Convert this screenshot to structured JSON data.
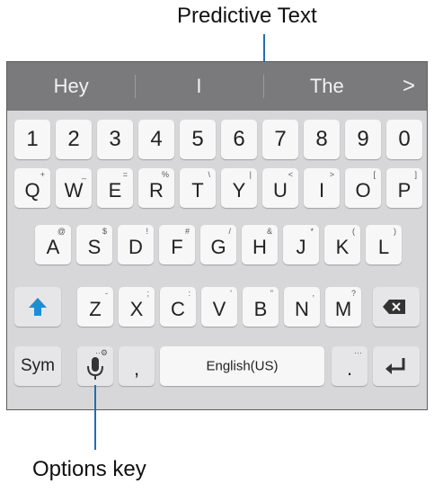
{
  "callouts": {
    "top": "Predictive Text",
    "bottom": "Options key"
  },
  "prediction": {
    "words": [
      "Hey",
      "I",
      "The"
    ],
    "more": ">"
  },
  "keyboard": {
    "numbers": [
      "1",
      "2",
      "3",
      "4",
      "5",
      "6",
      "7",
      "8",
      "9",
      "0"
    ],
    "row1": [
      {
        "main": "Q",
        "sub": "+"
      },
      {
        "main": "W",
        "sub": "_"
      },
      {
        "main": "E",
        "sub": "="
      },
      {
        "main": "R",
        "sub": "%"
      },
      {
        "main": "T",
        "sub": "\\"
      },
      {
        "main": "Y",
        "sub": "|"
      },
      {
        "main": "U",
        "sub": "<"
      },
      {
        "main": "I",
        "sub": ">"
      },
      {
        "main": "O",
        "sub": "["
      },
      {
        "main": "P",
        "sub": "]"
      }
    ],
    "row2": [
      {
        "main": "A",
        "sub": "@"
      },
      {
        "main": "S",
        "sub": "$"
      },
      {
        "main": "D",
        "sub": "!"
      },
      {
        "main": "F",
        "sub": "#"
      },
      {
        "main": "G",
        "sub": "/"
      },
      {
        "main": "H",
        "sub": "&"
      },
      {
        "main": "J",
        "sub": "*"
      },
      {
        "main": "K",
        "sub": "("
      },
      {
        "main": "L",
        "sub": ")"
      }
    ],
    "row3": [
      {
        "main": "Z",
        "sub": "-"
      },
      {
        "main": "X",
        "sub": ";"
      },
      {
        "main": "C",
        "sub": ":"
      },
      {
        "main": "V",
        "sub": "'"
      },
      {
        "main": "B",
        "sub": "\""
      },
      {
        "main": "N",
        "sub": ","
      },
      {
        "main": "M",
        "sub": "?"
      }
    ],
    "sym_label": "Sym",
    "comma_label": ",",
    "space_label": "English(US)",
    "period_label": ".",
    "period_sub": "···",
    "mic_sub": "··⚙",
    "accent_color": "#1a8fd6"
  }
}
